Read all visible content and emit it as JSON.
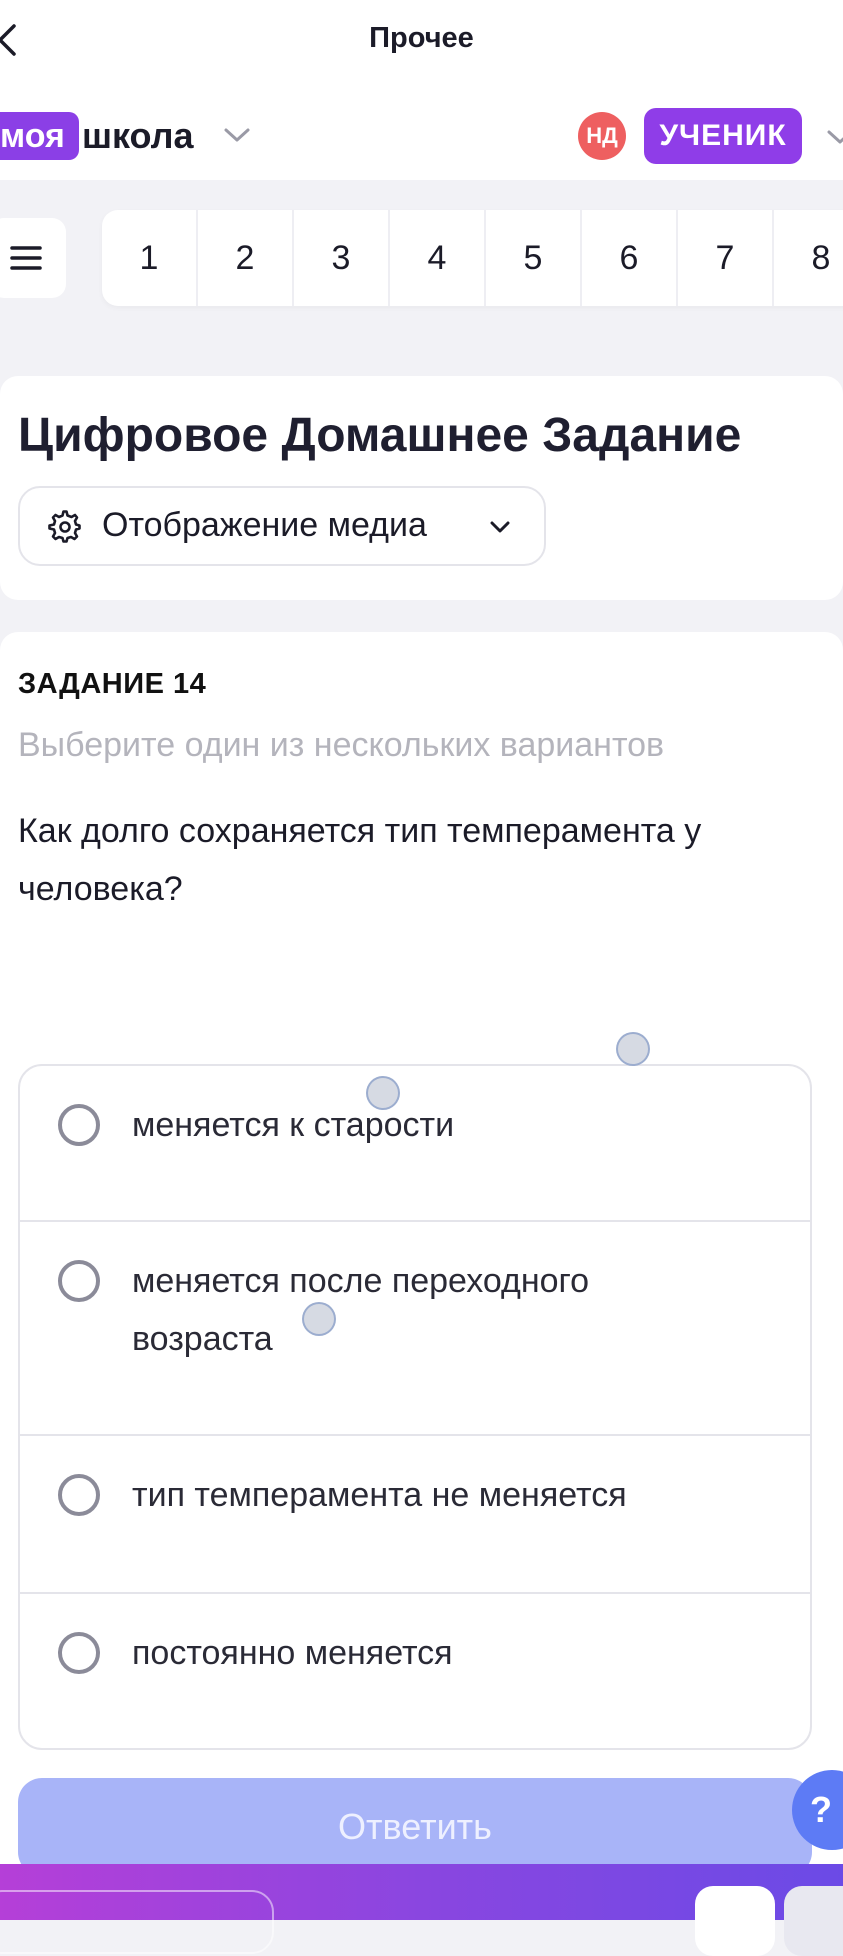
{
  "nav": {
    "title": "Прочее",
    "back_icon": "chevron-left-icon"
  },
  "header": {
    "logo_badge": "моя",
    "logo_text": "школа",
    "avatar_initials": "НД",
    "role": "УЧЕНИК"
  },
  "numbers": [
    "1",
    "2",
    "3",
    "4",
    "5",
    "6",
    "7",
    "8"
  ],
  "main": {
    "title": "Цифровое Домашнее Задание",
    "media_button": "Отображение медиа"
  },
  "task": {
    "label": "ЗАДАНИЕ 14",
    "hint": "Выберите один из нескольких вариантов",
    "question": "Как долго сохраняется тип темперамента у человека?",
    "options": [
      "меняется к старости",
      "меняется после переходного возраста",
      "тип темперамента не меняется",
      "постоянно меняется"
    ],
    "answer_button": "Ответить",
    "help": "?"
  },
  "colors": {
    "accent": "#8f3de8",
    "answer_disabled": "#a8b4f8",
    "avatar": "#ee5f60",
    "help": "#5d7bf5"
  }
}
